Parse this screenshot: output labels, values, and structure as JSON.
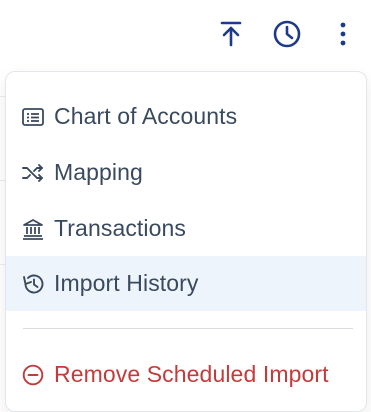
{
  "toolbar": {
    "icons": [
      "upload-to-top-icon",
      "clock-icon",
      "more-vertical-icon"
    ],
    "icon_color": "#1d3a8a"
  },
  "menu": {
    "items": [
      {
        "label": "Chart of Accounts",
        "icon": "list-alt-icon"
      },
      {
        "label": "Mapping",
        "icon": "shuffle-icon"
      },
      {
        "label": "Transactions",
        "icon": "bank-icon"
      },
      {
        "label": "Import History",
        "icon": "history-icon",
        "active": true
      }
    ],
    "danger_item": {
      "label": "Remove Scheduled Import",
      "icon": "minus-circle-icon"
    }
  },
  "colors": {
    "text": "#3a4a5e",
    "active_bg": "#eef4fb",
    "danger": "#c43b3b",
    "border": "#e3e6ea"
  }
}
